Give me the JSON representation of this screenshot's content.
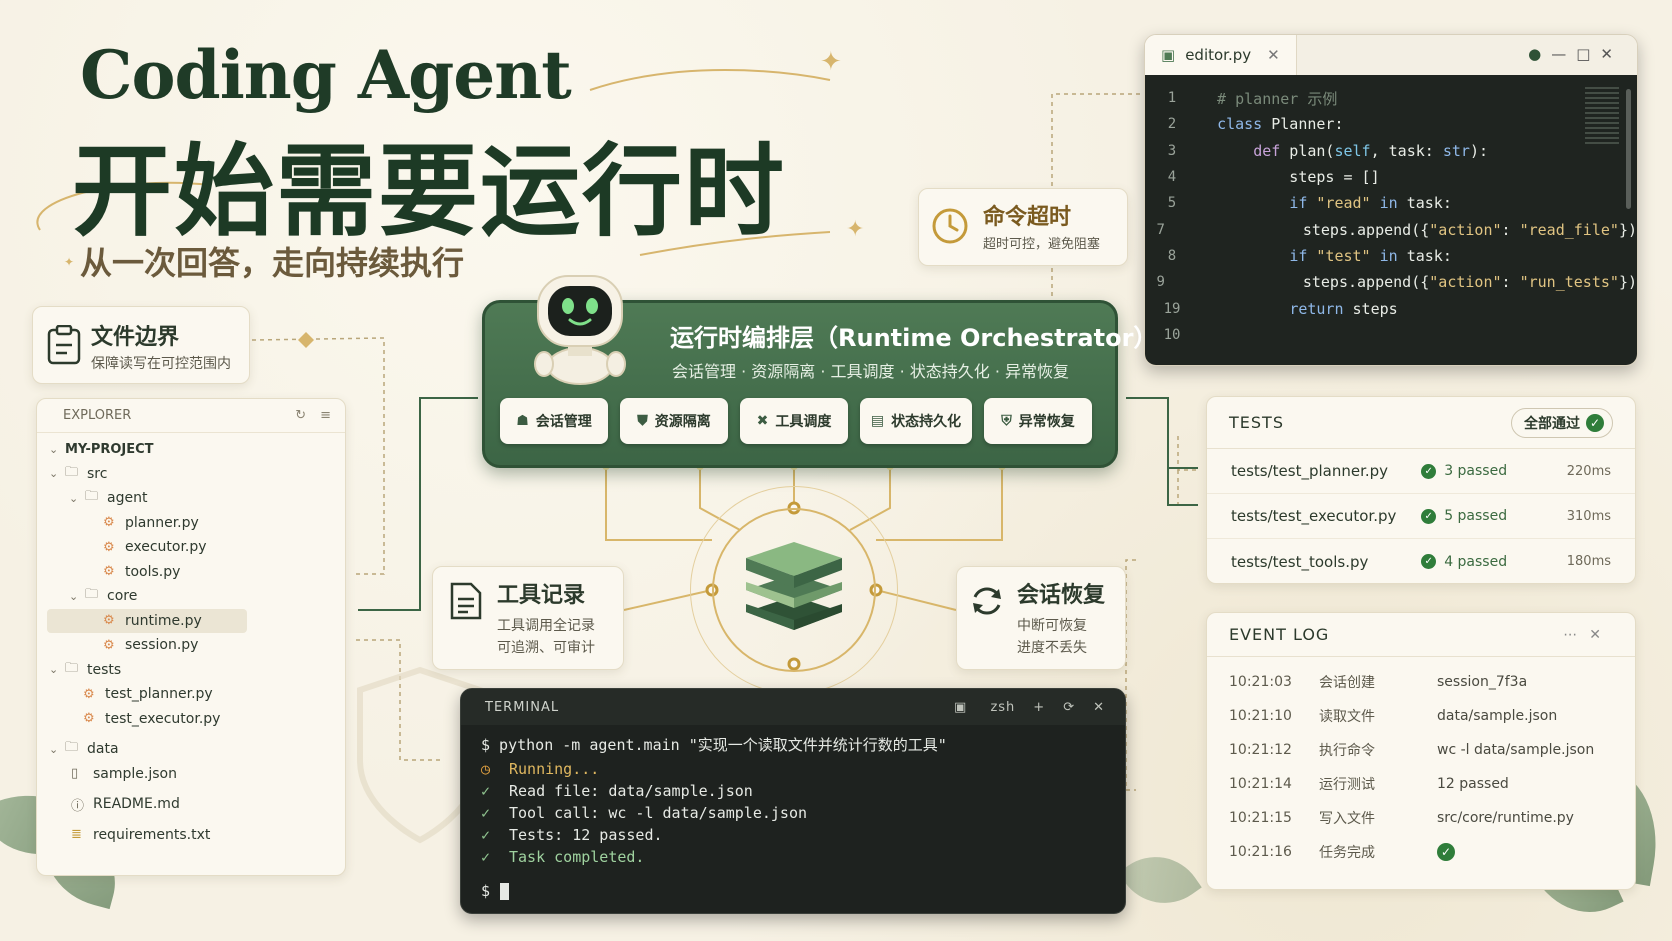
{
  "hero": {
    "title_en": "Coding Agent",
    "title_zh": "开始需要运行时",
    "subtitle": "从一次回答，走向持续执行"
  },
  "cards": {
    "file_boundary": {
      "title": "文件边界",
      "sub": "保障读写在可控范围内"
    },
    "command_timeout": {
      "title": "命令超时",
      "sub": "超时可控，避免阻塞"
    },
    "tool_record": {
      "title": "工具记录",
      "sub1": "工具调用全记录",
      "sub2": "可追溯、可审计"
    },
    "session_recovery": {
      "title": "会话恢复",
      "sub1": "中断可恢复",
      "sub2": "进度不丢失"
    }
  },
  "orchestrator": {
    "title": "运行时编排层（Runtime Orchestrator）",
    "subtitle": "会话管理 · 资源隔离 · 工具调度 · 状态持久化 · 异常恢复",
    "buttons": [
      {
        "label": "会话管理",
        "icon": "session-icon"
      },
      {
        "label": "资源隔离",
        "icon": "shield-icon"
      },
      {
        "label": "工具调度",
        "icon": "tools-icon"
      },
      {
        "label": "状态持久化",
        "icon": "storage-icon"
      },
      {
        "label": "异常恢复",
        "icon": "recovery-icon"
      }
    ]
  },
  "explorer": {
    "header": "EXPLORER",
    "project": "MY-PROJECT",
    "items": [
      {
        "label": "src",
        "type": "folder"
      },
      {
        "label": "agent",
        "type": "folder"
      },
      {
        "label": "planner.py",
        "type": "py"
      },
      {
        "label": "executor.py",
        "type": "py"
      },
      {
        "label": "tools.py",
        "type": "py"
      },
      {
        "label": "core",
        "type": "folder"
      },
      {
        "label": "runtime.py",
        "type": "py"
      },
      {
        "label": "session.py",
        "type": "py"
      },
      {
        "label": "tests",
        "type": "folder"
      },
      {
        "label": "test_planner.py",
        "type": "py"
      },
      {
        "label": "test_executor.py",
        "type": "py"
      },
      {
        "label": "data",
        "type": "folder"
      },
      {
        "label": "sample.json",
        "type": "json"
      },
      {
        "label": "README.md",
        "type": "md"
      },
      {
        "label": "requirements.txt",
        "type": "txt"
      }
    ]
  },
  "editor": {
    "tab": "editor.py",
    "line_numbers": [
      "1",
      "2",
      "3",
      "4",
      "5",
      "7",
      "8",
      "9",
      "19",
      "10"
    ]
  },
  "tests": {
    "header": "TESTS",
    "badge": "全部通过",
    "rows": [
      {
        "name": "tests/test_planner.py",
        "status": "3 passed",
        "time": "220ms"
      },
      {
        "name": "tests/test_executor.py",
        "status": "5 passed",
        "time": "310ms"
      },
      {
        "name": "tests/test_tools.py",
        "status": "4 passed",
        "time": "180ms"
      }
    ]
  },
  "event_log": {
    "header": "EVENT LOG",
    "rows": [
      {
        "time": "10:21:03",
        "action": "会话创建",
        "target": "session_7f3a"
      },
      {
        "time": "10:21:10",
        "action": "读取文件",
        "target": "data/sample.json"
      },
      {
        "time": "10:21:12",
        "action": "执行命令",
        "target": "wc -l data/sample.json"
      },
      {
        "time": "10:21:14",
        "action": "运行测试",
        "target": "12 passed"
      },
      {
        "time": "10:21:15",
        "action": "写入文件",
        "target": "src/core/runtime.py"
      },
      {
        "time": "10:21:16",
        "action": "任务完成",
        "target": ""
      }
    ]
  },
  "terminal": {
    "header": "TERMINAL",
    "shell": "zsh",
    "command": "$ python -m agent.main \"实现一个读取文件并统计行数的工具\"",
    "running": "Running...",
    "lines": [
      "Read file: data/sample.json",
      "Tool call: wc -l data/sample.json",
      "Tests: 12 passed."
    ],
    "done": "Task completed.",
    "prompt": "$"
  },
  "colors": {
    "primary_green": "#3c6545",
    "gold": "#c49a3a",
    "background": "#f6f1e4",
    "success": "#2f7d3a"
  }
}
